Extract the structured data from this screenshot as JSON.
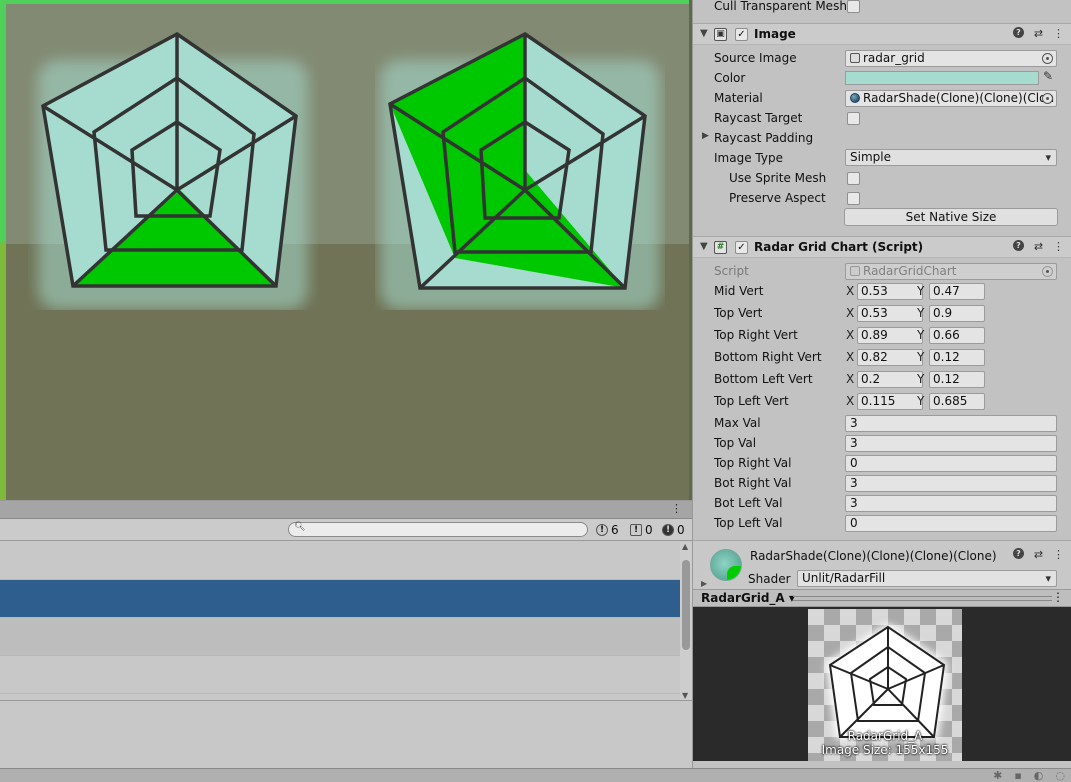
{
  "inspector": {
    "cull_label": "Cull Transparent Mesh",
    "image_component": {
      "title": "Image",
      "source_image_label": "Source Image",
      "source_image_value": "radar_grid",
      "color_label": "Color",
      "color_value": "#a6dccf",
      "material_label": "Material",
      "material_value": "RadarShade(Clone)(Clone)(Clon",
      "raycast_target_label": "Raycast Target",
      "raycast_padding_label": "Raycast Padding",
      "image_type_label": "Image Type",
      "image_type_value": "Simple",
      "use_sprite_mesh_label": "Use Sprite Mesh",
      "preserve_aspect_label": "Preserve Aspect",
      "set_native_size_label": "Set Native Size"
    },
    "radar_component": {
      "title": "Radar Grid Chart (Script)",
      "script_label": "Script",
      "script_value": "RadarGridChart",
      "x_label": "X",
      "y_label": "Y",
      "verts": [
        {
          "label": "Mid Vert",
          "x": "0.53",
          "y": "0.47"
        },
        {
          "label": "Top Vert",
          "x": "0.53",
          "y": "0.9"
        },
        {
          "label": "Top Right Vert",
          "x": "0.89",
          "y": "0.66"
        },
        {
          "label": "Bottom Right Vert",
          "x": "0.82",
          "y": "0.12"
        },
        {
          "label": "Bottom Left Vert",
          "x": "0.2",
          "y": "0.12"
        },
        {
          "label": "Top Left Vert",
          "x": "0.115",
          "y": "0.685"
        }
      ],
      "vals": [
        {
          "label": "Max Val",
          "value": "3"
        },
        {
          "label": "Top Val",
          "value": "3"
        },
        {
          "label": "Top Right Val",
          "value": "0"
        },
        {
          "label": "Bot Right Val",
          "value": "3"
        },
        {
          "label": "Bot Left Val",
          "value": "3"
        },
        {
          "label": "Top Left Val",
          "value": "0"
        }
      ]
    },
    "material": {
      "name": "RadarShade(Clone)(Clone)(Clone)(Clone)",
      "shader_label": "Shader",
      "shader_value": "Unlit/RadarFill"
    },
    "preview": {
      "title": "RadarGrid_A",
      "caption_name": "RadarGrid_A",
      "caption_size": "Image Size: 155x155"
    }
  },
  "console": {
    "counts": {
      "messages": "6",
      "warnings": "0",
      "errors": "0"
    }
  },
  "colors": {
    "fill_green": "#00c800",
    "grid_light": "#a6dccf",
    "selection_blue": "#2d5e8e"
  },
  "icons": [
    "image-icon",
    "script-icon",
    "help-icon",
    "presets-icon",
    "kebab-menu-icon",
    "search-icon",
    "info-icon",
    "warning-icon",
    "error-icon",
    "object-picker-icon",
    "eyedropper-icon"
  ]
}
